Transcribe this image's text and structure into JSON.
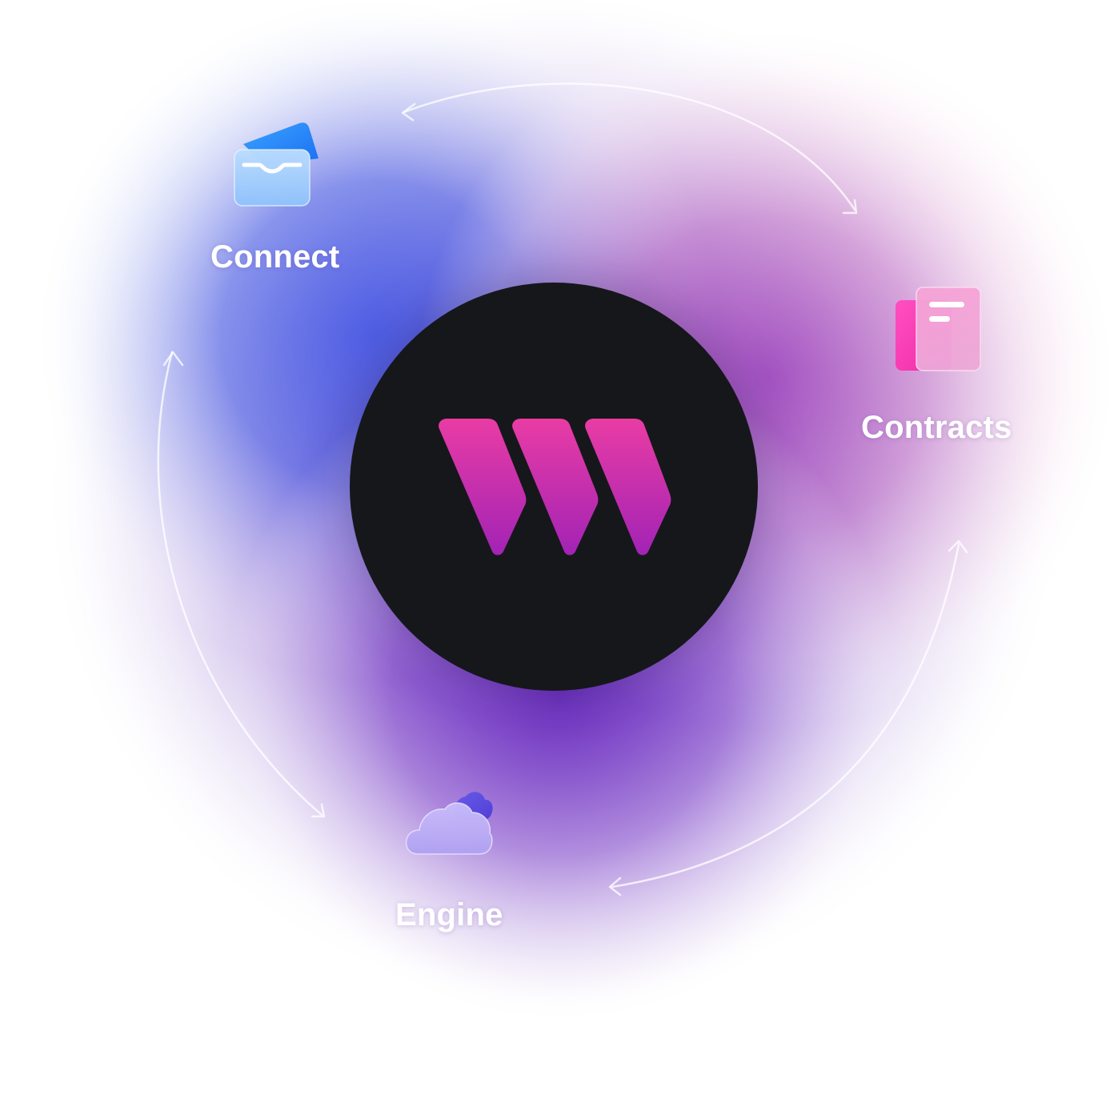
{
  "nodes": {
    "connect": {
      "label": "Connect",
      "icon": "wallet-card-icon",
      "color": "#2f8bf6"
    },
    "contracts": {
      "label": "Contracts",
      "icon": "document-stack-icon",
      "color": "#f23fb6"
    },
    "engine": {
      "label": "Engine",
      "icon": "cloud-icon",
      "color": "#8f79f0"
    }
  },
  "hub": {
    "logo": "w-logo-icon",
    "logo_color": "#e03a9f",
    "background": "#16171b"
  },
  "colors": {
    "blue_glow": "#5866e6",
    "purple_glow": "#7a3fc6",
    "pink_glow": "#d46fbf"
  }
}
